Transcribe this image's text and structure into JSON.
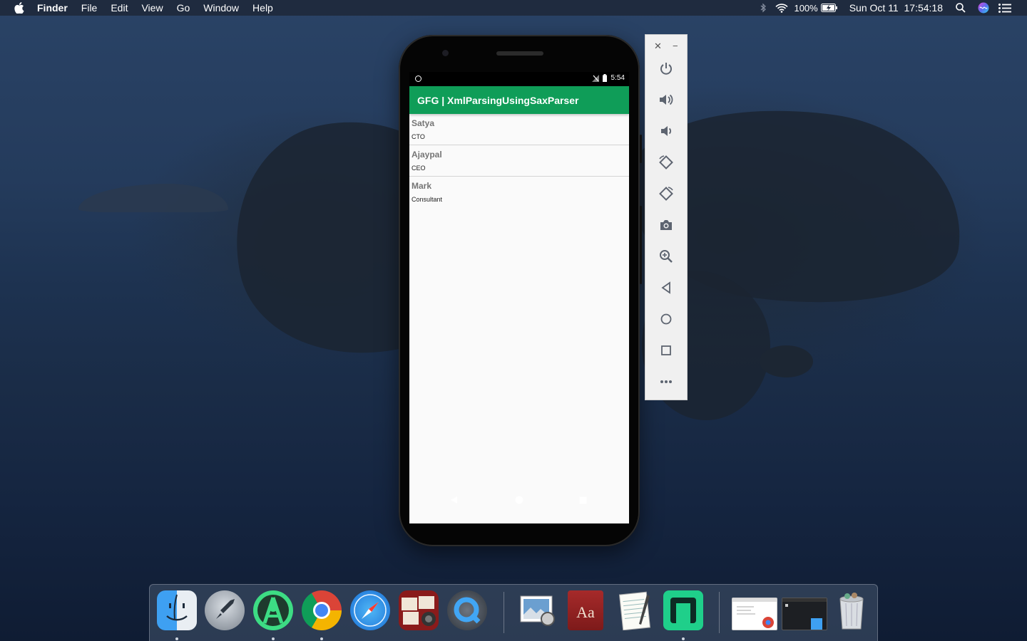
{
  "menubar": {
    "app": "Finder",
    "items": [
      "File",
      "Edit",
      "View",
      "Go",
      "Window",
      "Help"
    ],
    "battery": "100%",
    "clock": "Sun Oct 11  17:54:18"
  },
  "phone": {
    "status_time": "5:54",
    "app_title": "GFG | XmlParsingUsingSaxParser",
    "employees": [
      {
        "name": "Satya",
        "role": "CTO"
      },
      {
        "name": "Ajaypal",
        "role": "CEO"
      },
      {
        "name": "Mark",
        "role": "Consultant"
      }
    ]
  },
  "emulator_panel": {
    "controls": [
      "close-icon",
      "minimize-icon",
      "power-icon",
      "volume-up-icon",
      "volume-down-icon",
      "rotate-left-icon",
      "rotate-right-icon",
      "camera-icon",
      "zoom-icon",
      "back-icon",
      "home-icon",
      "overview-icon",
      "more-icon"
    ]
  },
  "dock": {
    "apps": [
      "Finder",
      "Launchpad",
      "Android Studio",
      "Google Chrome",
      "Safari",
      "Photo Booth",
      "QuickTime Player",
      "Preview",
      "Dictionary",
      "TextEdit",
      "Genymotion-like App",
      "Chrome Window",
      "Finder Window",
      "Trash"
    ]
  },
  "colors": {
    "appbar": "#0f9d58",
    "menubar": "#1e283a"
  }
}
